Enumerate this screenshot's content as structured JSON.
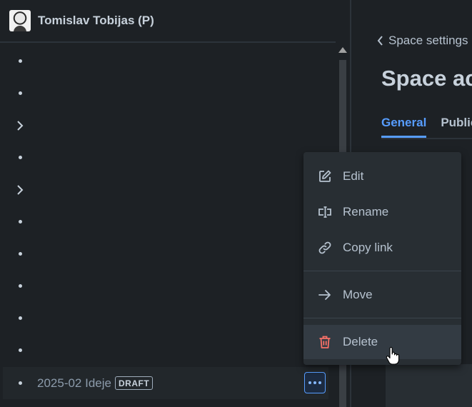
{
  "sidebar": {
    "user_name": "Tomislav Tobijas (P)",
    "tree": [
      {
        "marker": "bullet"
      },
      {
        "marker": "bullet"
      },
      {
        "marker": "chevron-right"
      },
      {
        "marker": "bullet"
      },
      {
        "marker": "chevron-right"
      },
      {
        "marker": "bullet"
      },
      {
        "marker": "bullet"
      },
      {
        "marker": "bullet"
      },
      {
        "marker": "bullet"
      },
      {
        "marker": "bullet"
      }
    ],
    "selected_page": {
      "title": "2025-02 Ideje",
      "badge": "DRAFT"
    }
  },
  "main": {
    "breadcrumb": "Space settings",
    "title": "Space ac",
    "tabs": [
      {
        "label": "General",
        "active": true
      },
      {
        "label": "Public",
        "active": false
      }
    ]
  },
  "menu": {
    "items": [
      {
        "label": "Edit",
        "icon": "edit-icon"
      },
      {
        "label": "Rename",
        "icon": "rename-icon"
      },
      {
        "label": "Copy link",
        "icon": "link-icon"
      },
      {
        "label": "Move",
        "icon": "arrow-right-icon"
      },
      {
        "label": "Delete",
        "icon": "trash-icon"
      }
    ]
  },
  "colors": {
    "background": "#1d2125",
    "accent": "#579dff",
    "danger": "#f87168",
    "menu_bg": "#282e33"
  }
}
